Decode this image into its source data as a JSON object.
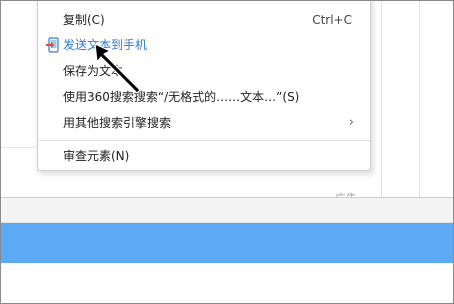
{
  "context_menu": {
    "items": [
      {
        "label": "复制(C)",
        "shortcut": "Ctrl+C"
      },
      {
        "label": "发送文本到手机",
        "icon": "send-to-phone-icon"
      },
      {
        "label": "保存为文本"
      },
      {
        "label": "使用360搜索搜索“/无格式的……文本…”(S)"
      },
      {
        "label": "用其他搜索引擎搜索",
        "has_submenu": true,
        "submenu_indicator": "›"
      },
      {
        "label": "审查元素(N)"
      }
    ]
  },
  "background": {
    "ad_label": "广告"
  },
  "colors": {
    "accent_blue": "#5ea9f5",
    "link_blue": "#2a7ad8"
  }
}
